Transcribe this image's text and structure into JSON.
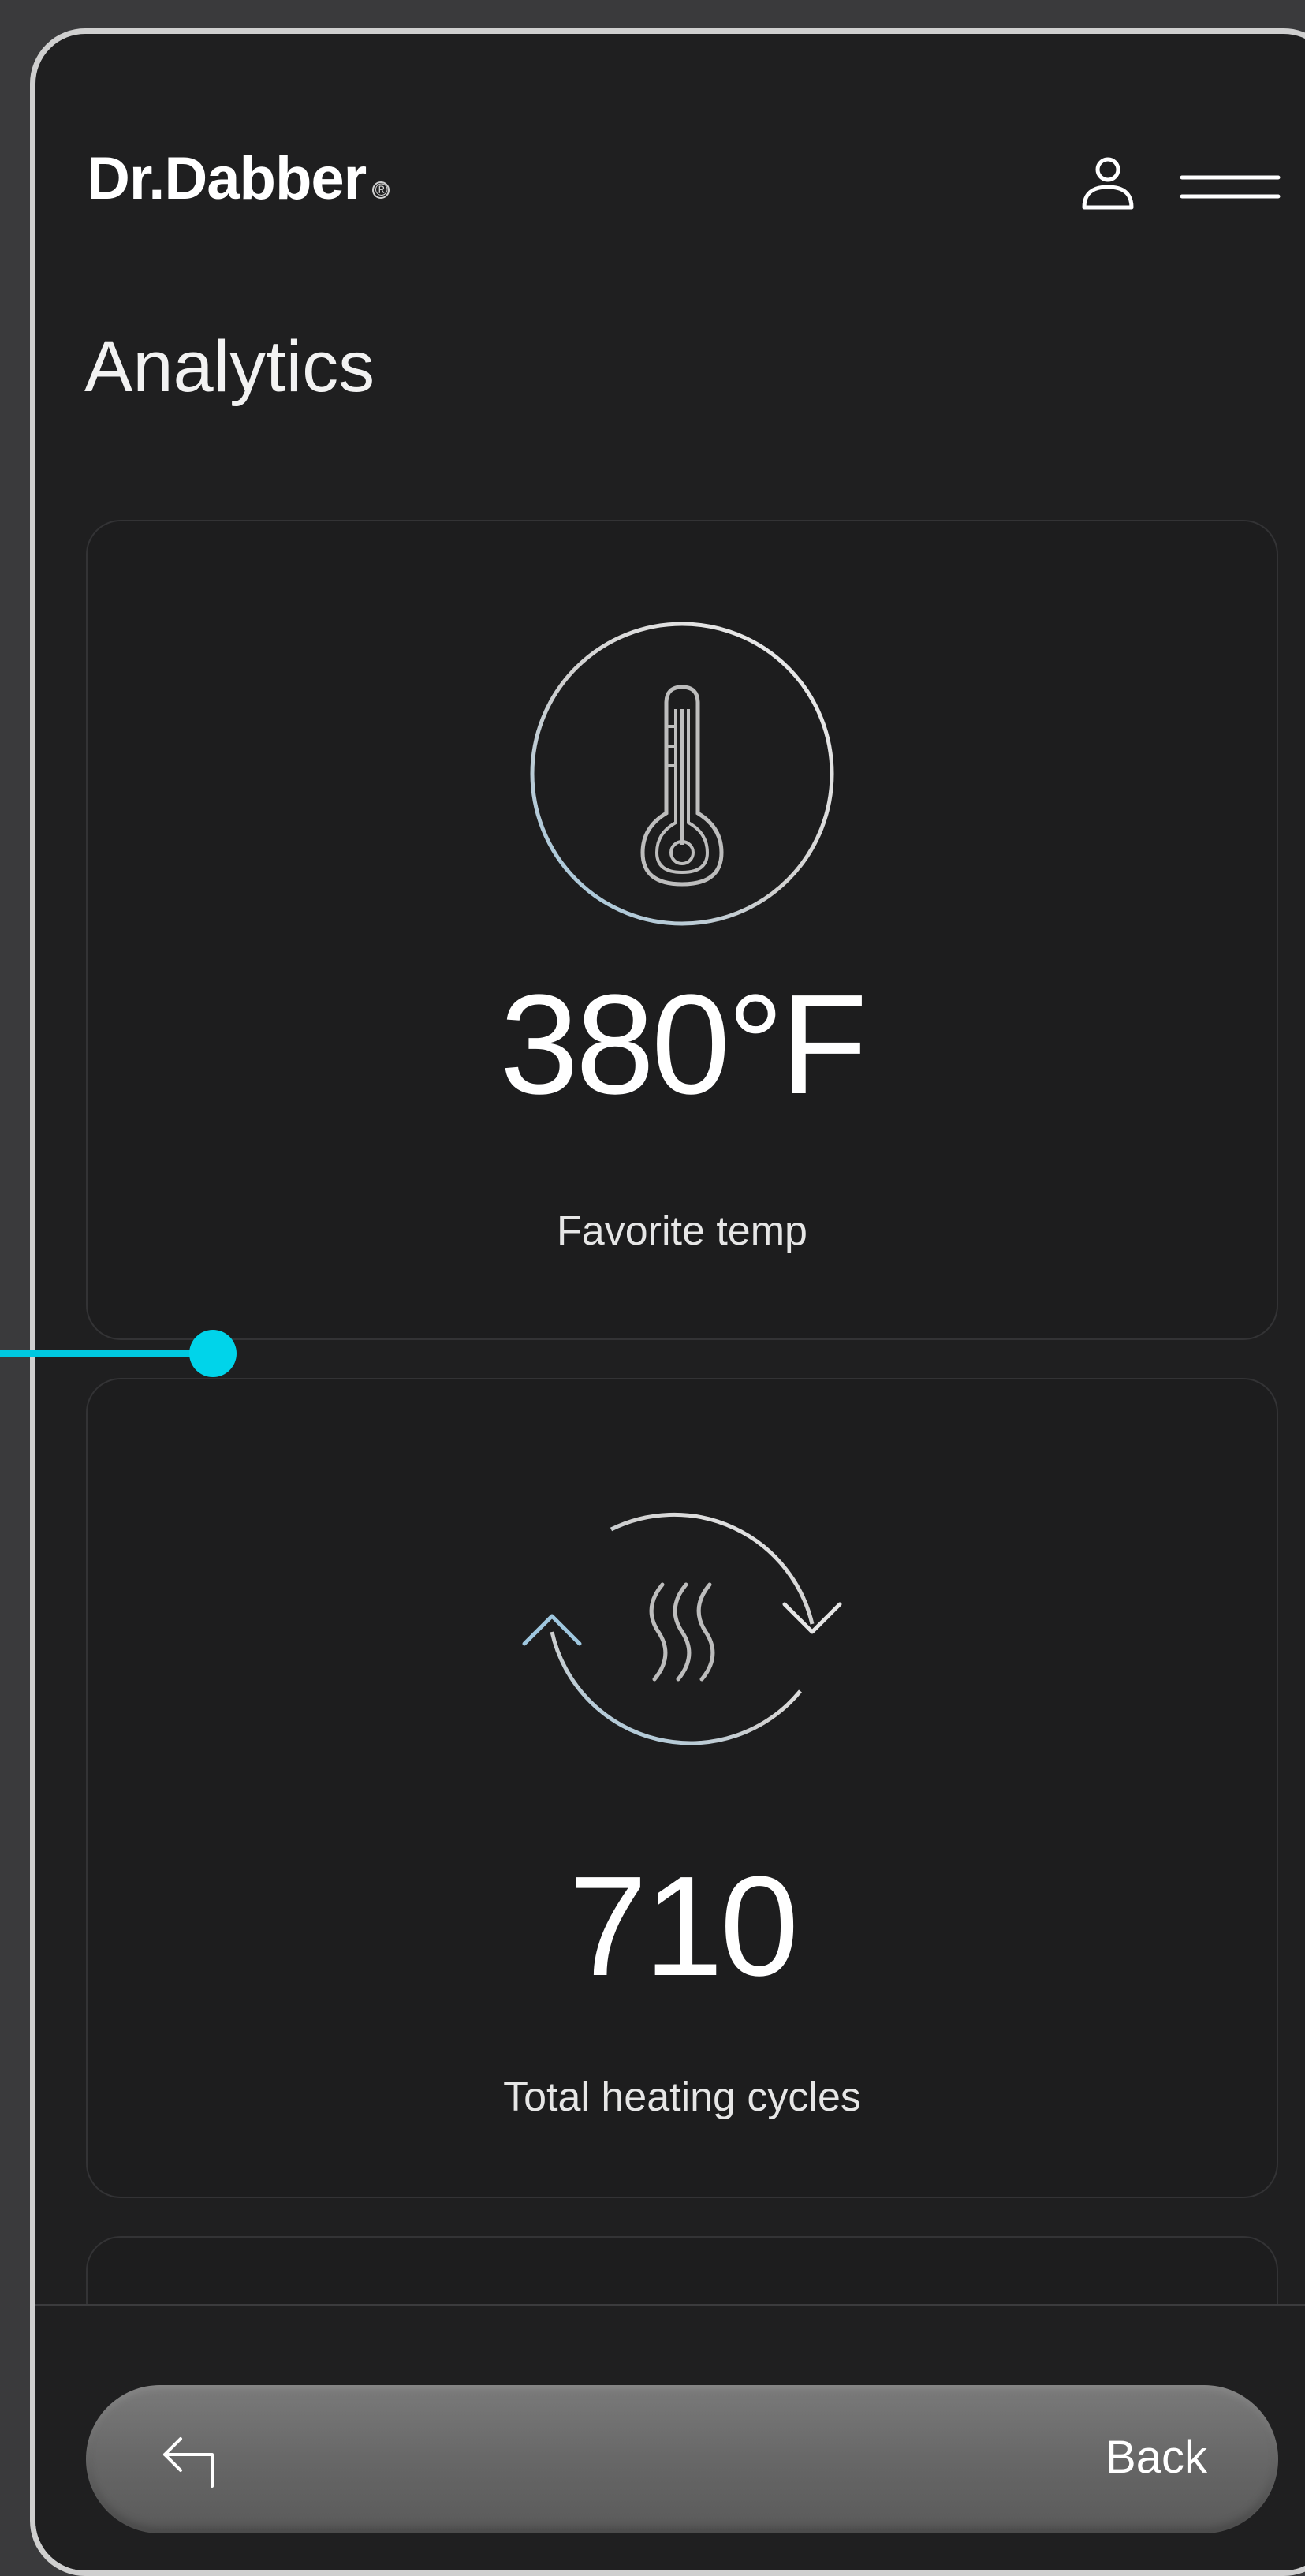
{
  "header": {
    "brand": "Dr.Dabber",
    "brand_mark": "®",
    "user_icon": "user-icon",
    "menu_icon": "hamburger-menu-icon"
  },
  "page": {
    "title": "Analytics"
  },
  "cards": [
    {
      "icon": "thermometer-icon",
      "value": "380°F",
      "label": "Favorite temp"
    },
    {
      "icon": "heating-cycle-icon",
      "value": "710",
      "label": "Total heating cycles"
    }
  ],
  "footer": {
    "back_icon": "back-arrow-icon",
    "back_label": "Back"
  },
  "colors": {
    "background": "#1f1f20",
    "card_border": "#333335",
    "accent": "#00c8e0",
    "text": "#ffffff"
  }
}
